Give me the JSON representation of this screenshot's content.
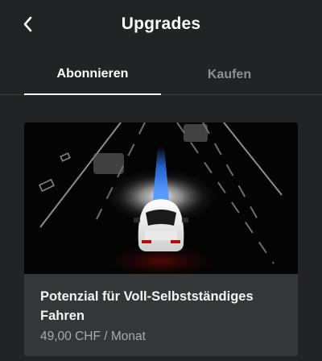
{
  "header": {
    "title": "Upgrades",
    "back_icon": "chevron-left-icon"
  },
  "tabs": [
    {
      "label": "Abonnieren",
      "active": true
    },
    {
      "label": "Kaufen",
      "active": false
    }
  ],
  "card": {
    "title": "Potenzial für Voll-Selbstständiges Fahren",
    "price": "49,00 CHF / Monat",
    "image": "autopilot-car-illustration"
  },
  "colors": {
    "background": "#222324",
    "card": "#353638",
    "accent_blue": "#2f7dff",
    "inactive_text": "#8e8f92"
  }
}
